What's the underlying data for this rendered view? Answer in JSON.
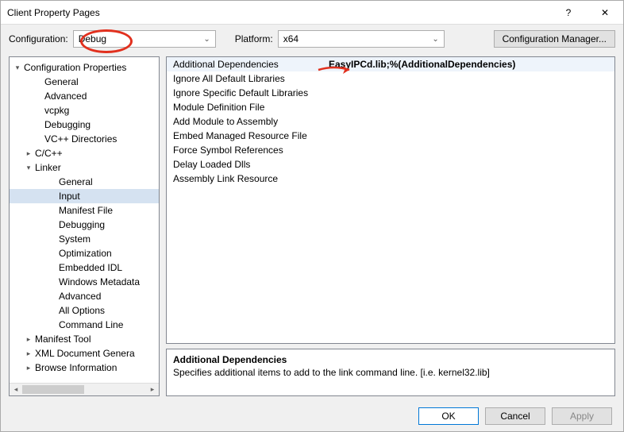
{
  "window": {
    "title": "Client Property Pages",
    "help": "?",
    "close": "✕"
  },
  "toprow": {
    "config_label": "Configuration:",
    "config_value": "Debug",
    "platform_label": "Platform:",
    "platform_value": "x64",
    "manager_btn": "Configuration Manager..."
  },
  "tree": [
    {
      "t": "▾",
      "lvl": "i0",
      "label": "Configuration Properties",
      "exp": true
    },
    {
      "t": "",
      "lvl": "i1",
      "label": "General"
    },
    {
      "t": "",
      "lvl": "i1",
      "label": "Advanced"
    },
    {
      "t": "",
      "lvl": "i1",
      "label": "vcpkg"
    },
    {
      "t": "",
      "lvl": "i1",
      "label": "Debugging"
    },
    {
      "t": "",
      "lvl": "i1",
      "label": "VC++ Directories"
    },
    {
      "t": "▸",
      "lvl": "i1b",
      "label": "C/C++"
    },
    {
      "t": "▾",
      "lvl": "i1b",
      "label": "Linker",
      "exp": true
    },
    {
      "t": "",
      "lvl": "i2",
      "label": "General"
    },
    {
      "t": "",
      "lvl": "i2",
      "label": "Input",
      "sel": true
    },
    {
      "t": "",
      "lvl": "i2",
      "label": "Manifest File"
    },
    {
      "t": "",
      "lvl": "i2",
      "label": "Debugging"
    },
    {
      "t": "",
      "lvl": "i2",
      "label": "System"
    },
    {
      "t": "",
      "lvl": "i2",
      "label": "Optimization"
    },
    {
      "t": "",
      "lvl": "i2",
      "label": "Embedded IDL"
    },
    {
      "t": "",
      "lvl": "i2",
      "label": "Windows Metadata"
    },
    {
      "t": "",
      "lvl": "i2",
      "label": "Advanced"
    },
    {
      "t": "",
      "lvl": "i2",
      "label": "All Options"
    },
    {
      "t": "",
      "lvl": "i2",
      "label": "Command Line"
    },
    {
      "t": "▸",
      "lvl": "i1b",
      "label": "Manifest Tool"
    },
    {
      "t": "▸",
      "lvl": "i1b",
      "label": "XML Document Genera"
    },
    {
      "t": "▸",
      "lvl": "i1b",
      "label": "Browse Information"
    }
  ],
  "grid": [
    {
      "name": "Additional Dependencies",
      "val": "EasyIPCd.lib;%(AdditionalDependencies)",
      "bold": true,
      "sel": true
    },
    {
      "name": "Ignore All Default Libraries",
      "val": ""
    },
    {
      "name": "Ignore Specific Default Libraries",
      "val": ""
    },
    {
      "name": "Module Definition File",
      "val": ""
    },
    {
      "name": "Add Module to Assembly",
      "val": ""
    },
    {
      "name": "Embed Managed Resource File",
      "val": ""
    },
    {
      "name": "Force Symbol References",
      "val": ""
    },
    {
      "name": "Delay Loaded Dlls",
      "val": ""
    },
    {
      "name": "Assembly Link Resource",
      "val": ""
    }
  ],
  "desc": {
    "title": "Additional Dependencies",
    "body": "Specifies additional items to add to the link command line. [i.e. kernel32.lib]"
  },
  "buttons": {
    "ok": "OK",
    "cancel": "Cancel",
    "apply": "Apply"
  }
}
